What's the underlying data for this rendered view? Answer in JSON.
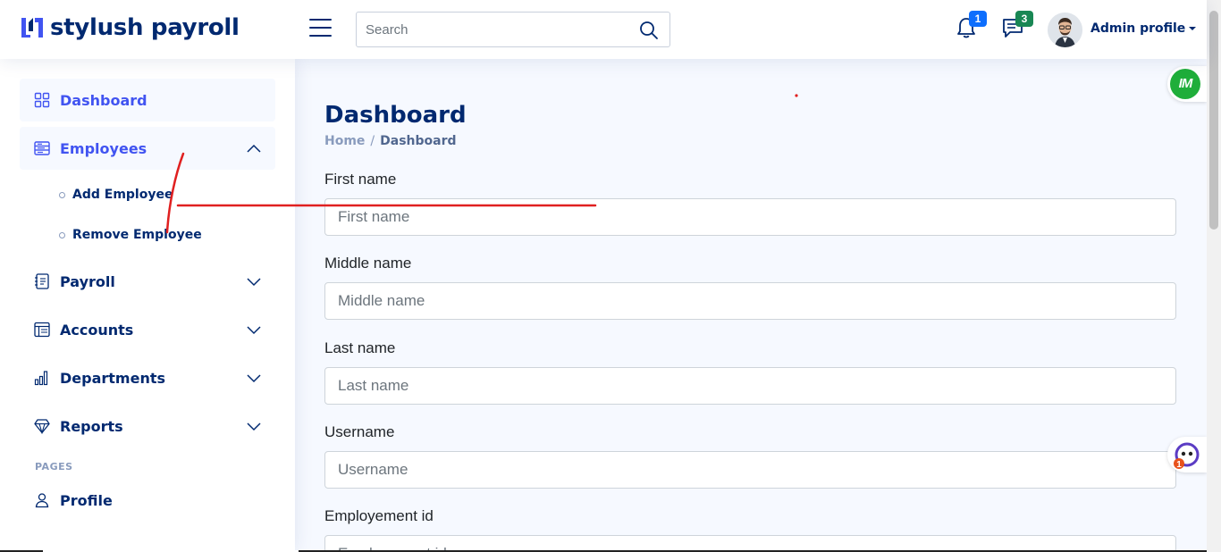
{
  "header": {
    "brand": "stylush payroll",
    "search_placeholder": "Search",
    "notifications_count": "1",
    "messages_count": "3",
    "profile_label": "Admin profile"
  },
  "sidebar": {
    "items": [
      {
        "label": "Dashboard",
        "icon": "grid-icon"
      },
      {
        "label": "Employees",
        "icon": "layout-text-icon",
        "expanded": true
      },
      {
        "label": "Payroll",
        "icon": "journal-text-icon"
      },
      {
        "label": "Accounts",
        "icon": "table-icon"
      },
      {
        "label": "Departments",
        "icon": "bar-chart-icon"
      },
      {
        "label": "Reports",
        "icon": "gem-icon"
      }
    ],
    "employees_sub": [
      {
        "label": "Add Employee"
      },
      {
        "label": "Remove Employee"
      }
    ],
    "pages_heading": "PAGES",
    "pages": [
      {
        "label": "Profile",
        "icon": "person-icon"
      }
    ]
  },
  "main": {
    "title": "Dashboard",
    "breadcrumb": {
      "home": "Home",
      "separator": "/",
      "current": "Dashboard"
    },
    "fields": [
      {
        "label": "First name",
        "placeholder": "First name"
      },
      {
        "label": "Middle name",
        "placeholder": "Middle name"
      },
      {
        "label": "Last name",
        "placeholder": "Last name"
      },
      {
        "label": "Username",
        "placeholder": "Username"
      },
      {
        "label": "Employement id",
        "placeholder": "Employement id"
      }
    ]
  },
  "widgets": {
    "im_label": "IM",
    "chat_badge": "1"
  },
  "colors": {
    "brand": "#012970",
    "accent": "#4154f1",
    "notification_badge": "#0d6efd",
    "message_badge": "#198754",
    "annotation": "#e02020"
  }
}
